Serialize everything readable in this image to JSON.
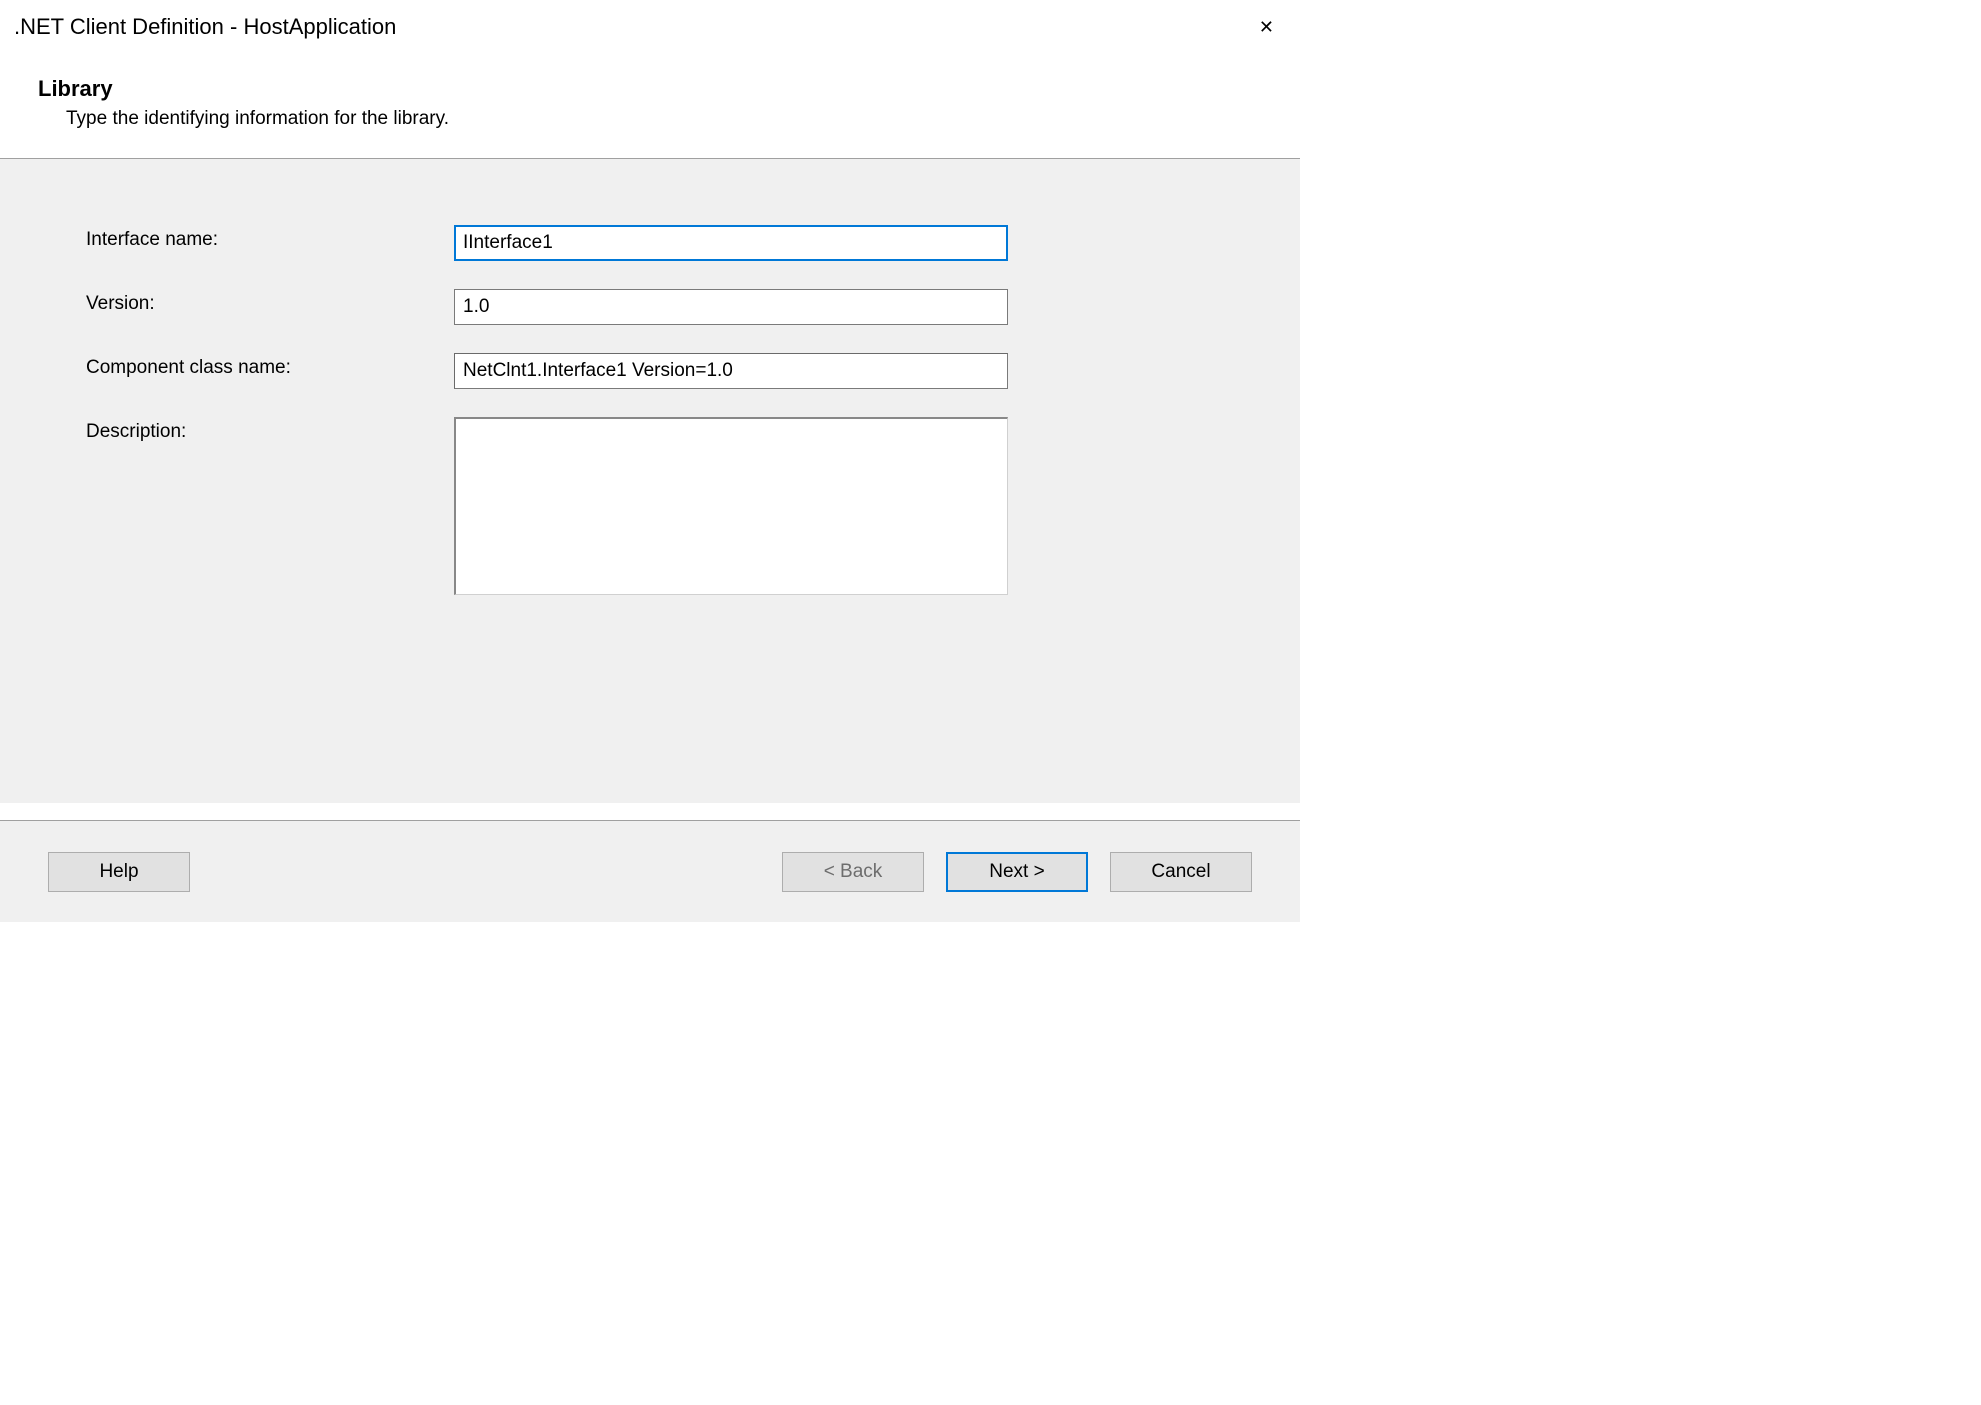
{
  "window": {
    "title": ".NET Client Definition - HostApplication",
    "close_label": "✕"
  },
  "header": {
    "title": "Library",
    "subtitle": "Type the identifying information for the library."
  },
  "form": {
    "interface_name_label": "Interface name:",
    "interface_name_value": "IInterface1",
    "version_label": "Version:",
    "version_value": "1.0",
    "component_class_label": "Component class name:",
    "component_class_value": "NetClnt1.Interface1 Version=1.0",
    "description_label": "Description:",
    "description_value": ""
  },
  "footer": {
    "help_label": "Help",
    "back_label": "< Back",
    "next_label": "Next >",
    "cancel_label": "Cancel"
  }
}
